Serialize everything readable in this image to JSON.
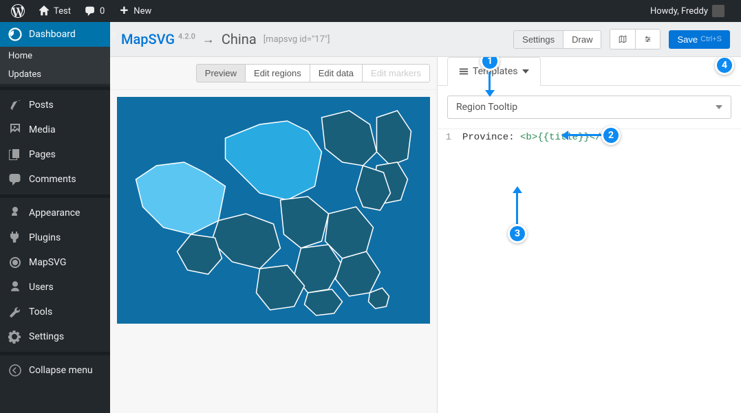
{
  "adminBar": {
    "siteName": "Test",
    "commentsCount": "0",
    "newLabel": "New",
    "howdy": "Howdy, Freddy"
  },
  "sidebar": {
    "dashboard": "Dashboard",
    "home": "Home",
    "updates": "Updates",
    "posts": "Posts",
    "media": "Media",
    "pages": "Pages",
    "comments": "Comments",
    "appearance": "Appearance",
    "plugins": "Plugins",
    "mapsvg": "MapSVG",
    "users": "Users",
    "tools": "Tools",
    "settings": "Settings",
    "collapse": "Collapse menu"
  },
  "header": {
    "brand": "MapSVG",
    "version": "4.2.0",
    "arrow": "→",
    "title": "China",
    "shortcode": "[mapsvg id=\"17\"]",
    "settings": "Settings",
    "draw": "Draw",
    "save": "Save",
    "saveKbd": "Ctrl+S"
  },
  "leftToolbar": {
    "preview": "Preview",
    "editRegions": "Edit regions",
    "editData": "Edit data",
    "editMarkers": "Edit markers"
  },
  "rightPanel": {
    "templatesTab": "Templates",
    "selected": "Region Tooltip"
  },
  "code": {
    "lineNum": "1",
    "text": "Province: ",
    "tagOpen": "<b>",
    "variable": "{{title}}",
    "tagClose": "</b>"
  },
  "annotations": {
    "a1": "1",
    "a2": "2",
    "a3": "3",
    "a4": "4"
  }
}
